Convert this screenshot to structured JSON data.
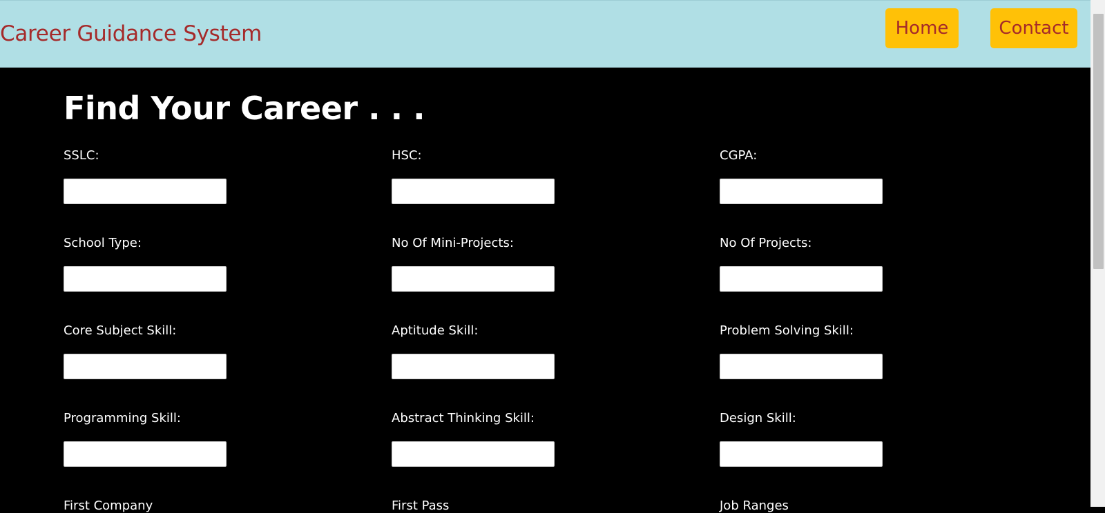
{
  "navbar": {
    "brand": "Career Guidance System",
    "home_label": "Home",
    "contact_label": "Contact"
  },
  "main": {
    "title": "Find Your Career . . .",
    "fields": {
      "sslc": "SSLC:",
      "hsc": "HSC:",
      "cgpa": "CGPA:",
      "school_type": "School Type:",
      "mini_projects": "No Of Mini-Projects:",
      "projects": "No Of Projects:",
      "core_subject": "Core Subject Skill:",
      "aptitude": "Aptitude Skill:",
      "problem_solving": "Problem Solving Skill:",
      "programming": "Programming Skill:",
      "abstract_thinking": "Abstract Thinking Skill:",
      "design": "Design Skill:",
      "partial_1": "First Company",
      "partial_2": "First Pass",
      "partial_3": "Job Ranges"
    }
  }
}
